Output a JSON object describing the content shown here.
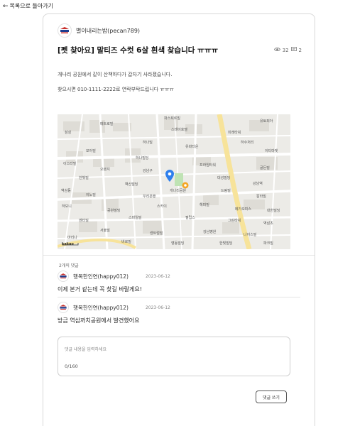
{
  "nav": {
    "back_label": "목록으로 돌아가기",
    "back_icon": "arrow-left-icon"
  },
  "post": {
    "author": "별이내리는밤(pecan789)",
    "title": "[펫 찾아요] 말티즈 수컷 6살 흰색 찾습니다 ㅠㅠㅠ",
    "views": "32",
    "comments_stat": "2",
    "body_lines": [
      "개나리 공원에서 같이 산책하다가 갑자기 사라졌습니다.",
      "찾으시면 010-1111-2222로 연락부탁드립니다 ㅠㅠㅠ"
    ]
  },
  "map": {
    "labels": [
      "파스퇴르빌",
      "메트로빌",
      "삼성",
      "미래타워",
      "하나빌",
      "스테이호텔",
      "유토피아",
      "모아빌",
      "하나빌딩",
      "유화타운",
      "하수처리",
      "이티마켓",
      "이스타빌",
      "오렌지",
      "강남구",
      "프라임타워",
      "골든빌",
      "한빛빌",
      "벽산빌딩",
      "대성빌딩",
      "강남역",
      "역삼동",
      "이노빌",
      "우리은행",
      "드림빌",
      "칼라빌",
      "하모니",
      "공원빌딩",
      "스카이",
      "해피빌",
      "메가오피스",
      "대한빌딩",
      "엔터빌",
      "개나리공원",
      "스마일빌",
      "필립스",
      "그린타워",
      "역삼초",
      "서울빌",
      "센트럴빌",
      "강남병원",
      "나이스빌",
      "마리나",
      "바로빌",
      "영동빌딩",
      "한빛빌딩",
      "파크빌"
    ],
    "pin_color": "#2f80ed",
    "marker_color": "#f5a623",
    "scale_label": "kakao"
  },
  "comments": {
    "count_label": "2개의 댓글",
    "items": [
      {
        "name": "행복한인연(happy012)",
        "date": "2023-06-12",
        "text": "이제 본거 같는데 꼭 찾길 바랄게요!"
      },
      {
        "name": "행복한인연(happy012)",
        "date": "2023-06-12",
        "text": "방금 역삼까치공원에서 발견했어요"
      }
    ]
  },
  "composer": {
    "placeholder": "댓글 내용을 입력하세요",
    "counter": "0/160",
    "submit_label": "댓글 쓰기"
  },
  "colors": {
    "accent": "#2f80ed",
    "map_road": "#ffffff",
    "map_bg": "#ecebe7",
    "map_yellow": "#f7e39a"
  }
}
